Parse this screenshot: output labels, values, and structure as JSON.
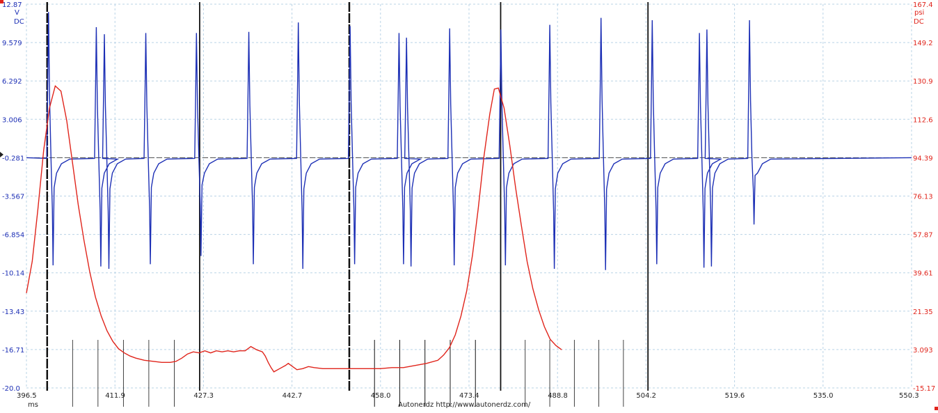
{
  "chart_data": {
    "type": "line",
    "x_label": "ms",
    "x_range": [
      396.5,
      550.3
    ],
    "x_ticks": [
      "396.5",
      "411.9",
      "427.3",
      "442.7",
      "458.0",
      "473.4",
      "488.8",
      "504.2",
      "519.6",
      "535.0",
      "550.3"
    ],
    "left_axis": {
      "unit_line1": "V",
      "unit_line2": "DC",
      "range": [
        -20.0,
        12.87
      ],
      "ticks": [
        "12.87",
        "9.579",
        "6.292",
        "3.006",
        "-0.281",
        "-3.567",
        "-6.854",
        "-10.14",
        "-13.43",
        "-16.71",
        "-20.0"
      ],
      "color": "#1c2fb5"
    },
    "right_axis": {
      "unit_line1": "psi",
      "unit_line2": "DC",
      "range": [
        -15.17,
        167.4
      ],
      "ticks": [
        "167.4",
        "149.2",
        "130.9",
        "112.6",
        "94.39",
        "76.13",
        "57.87",
        "39.61",
        "21.35",
        "3.093",
        "-15.17"
      ],
      "color": "#e0241b"
    },
    "grid": true,
    "cycle_markers_ms": [
      400.1,
      426.6,
      452.6,
      478.9,
      504.5
    ],
    "series": [
      {
        "axis": "left",
        "color": "#1c2fb5",
        "baseline": -0.281,
        "spikes": [
          {
            "t": 400.4,
            "high": 12.2,
            "low": -9.5
          },
          {
            "t": 408.7,
            "high": 10.9,
            "low": -9.6
          },
          {
            "t": 410.1,
            "high": 10.3,
            "low": -9.8
          },
          {
            "t": 417.3,
            "high": 10.4,
            "low": -9.4
          },
          {
            "t": 426.1,
            "high": 10.4,
            "low": -8.7
          },
          {
            "t": 435.2,
            "high": 10.5,
            "low": -9.4
          },
          {
            "t": 443.8,
            "high": 11.3,
            "low": -9.8
          },
          {
            "t": 452.8,
            "high": 11.0,
            "low": -9.4
          },
          {
            "t": 461.3,
            "high": 10.4,
            "low": -9.4
          },
          {
            "t": 462.6,
            "high": 10.0,
            "low": -9.6
          },
          {
            "t": 470.1,
            "high": 10.8,
            "low": -9.5
          },
          {
            "t": 479.0,
            "high": 10.7,
            "low": -9.5
          },
          {
            "t": 487.5,
            "high": 11.1,
            "low": -9.8
          },
          {
            "t": 496.4,
            "high": 11.7,
            "low": -9.9
          },
          {
            "t": 505.3,
            "high": 11.5,
            "low": -9.4
          },
          {
            "t": 513.5,
            "high": 10.4,
            "low": -9.7
          },
          {
            "t": 514.8,
            "high": 10.7,
            "low": -9.6
          },
          {
            "t": 522.2,
            "high": 11.5,
            "low": -6.0
          }
        ]
      },
      {
        "axis": "right",
        "color": "#e0241b",
        "points": [
          [
            396.5,
            30
          ],
          [
            397.5,
            45
          ],
          [
            398.5,
            70
          ],
          [
            399.5,
            98
          ],
          [
            400.5,
            118
          ],
          [
            401.5,
            128.5
          ],
          [
            402.5,
            126
          ],
          [
            403.5,
            112
          ],
          [
            404.5,
            92
          ],
          [
            405.5,
            72
          ],
          [
            406.5,
            55
          ],
          [
            407.5,
            40
          ],
          [
            408.5,
            28
          ],
          [
            409.5,
            19
          ],
          [
            410.5,
            12
          ],
          [
            411.5,
            7
          ],
          [
            412.5,
            3.5
          ],
          [
            413.5,
            1.5
          ],
          [
            414.5,
            0
          ],
          [
            415.5,
            -1
          ],
          [
            417.0,
            -2
          ],
          [
            418.5,
            -2.5
          ],
          [
            420.0,
            -3
          ],
          [
            421.5,
            -3
          ],
          [
            422.5,
            -2.5
          ],
          [
            423.5,
            -1
          ],
          [
            424.5,
            1
          ],
          [
            425.5,
            2
          ],
          [
            426.5,
            1.5
          ],
          [
            427.5,
            2.5
          ],
          [
            428.5,
            1.5
          ],
          [
            429.5,
            2.5
          ],
          [
            430.5,
            2
          ],
          [
            431.5,
            2.5
          ],
          [
            432.5,
            2
          ],
          [
            433.5,
            2.5
          ],
          [
            434.5,
            2.5
          ],
          [
            435.5,
            4.5
          ],
          [
            436.5,
            3
          ],
          [
            437.5,
            2
          ],
          [
            438.0,
            0
          ],
          [
            438.5,
            -3
          ],
          [
            439.0,
            -5.5
          ],
          [
            439.5,
            -7.5
          ],
          [
            440.5,
            -6
          ],
          [
            441.5,
            -4.5
          ],
          [
            442.0,
            -3.5
          ],
          [
            442.5,
            -4.5
          ],
          [
            443.5,
            -6.5
          ],
          [
            444.5,
            -6
          ],
          [
            445.5,
            -5
          ],
          [
            446.5,
            -5.5
          ],
          [
            448.0,
            -6
          ],
          [
            450.0,
            -6
          ],
          [
            452.0,
            -6
          ],
          [
            454.0,
            -6
          ],
          [
            456.0,
            -6
          ],
          [
            458.0,
            -6
          ],
          [
            460.0,
            -5.5
          ],
          [
            462.0,
            -5.5
          ],
          [
            464.0,
            -4.5
          ],
          [
            466.0,
            -3.5
          ],
          [
            468.0,
            -2
          ],
          [
            469.0,
            0.5
          ],
          [
            470.0,
            4
          ],
          [
            471.0,
            10
          ],
          [
            472.0,
            19
          ],
          [
            473.0,
            31
          ],
          [
            474.0,
            48
          ],
          [
            475.0,
            70
          ],
          [
            476.0,
            95
          ],
          [
            477.0,
            115
          ],
          [
            477.8,
            127
          ],
          [
            478.5,
            127.5
          ],
          [
            479.5,
            118
          ],
          [
            480.5,
            100
          ],
          [
            481.5,
            80
          ],
          [
            482.5,
            62
          ],
          [
            483.5,
            45
          ],
          [
            484.5,
            32
          ],
          [
            485.5,
            22
          ],
          [
            486.5,
            14
          ],
          [
            487.5,
            8
          ],
          [
            488.5,
            5
          ],
          [
            489.5,
            3
          ]
        ]
      }
    ],
    "footer_text": "Autonerdz   http://www.autonerdz.com/"
  }
}
